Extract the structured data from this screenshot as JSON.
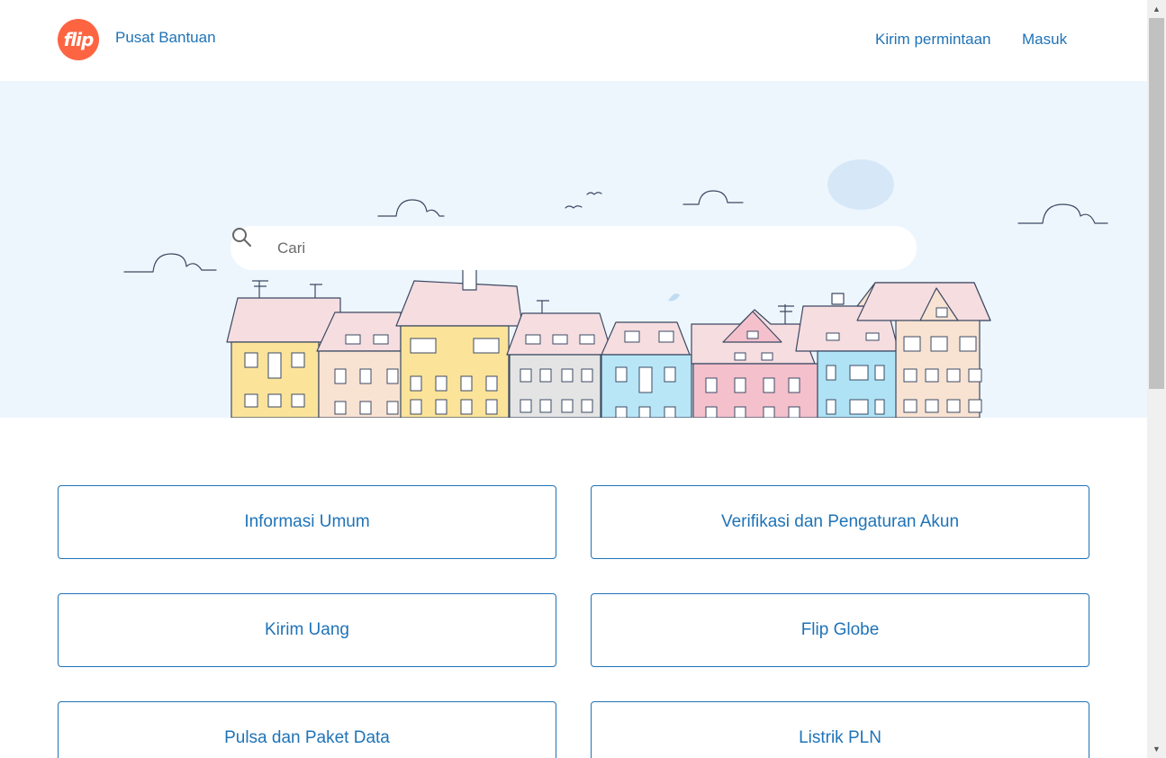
{
  "header": {
    "logo_text": "flip",
    "brand_title": "Pusat Bantuan",
    "nav": {
      "request_label": "Kirim permintaan",
      "login_label": "Masuk"
    }
  },
  "search": {
    "placeholder": "Cari"
  },
  "categories": [
    {
      "label": "Informasi Umum"
    },
    {
      "label": "Verifikasi dan Pengaturan Akun"
    },
    {
      "label": "Kirim Uang"
    },
    {
      "label": "Flip Globe"
    },
    {
      "label": "Pulsa dan Paket Data"
    },
    {
      "label": "Listrik PLN"
    }
  ],
  "colors": {
    "brand": "#fd6542",
    "link": "#1f73b7",
    "hero_background": "#eef6fd"
  }
}
